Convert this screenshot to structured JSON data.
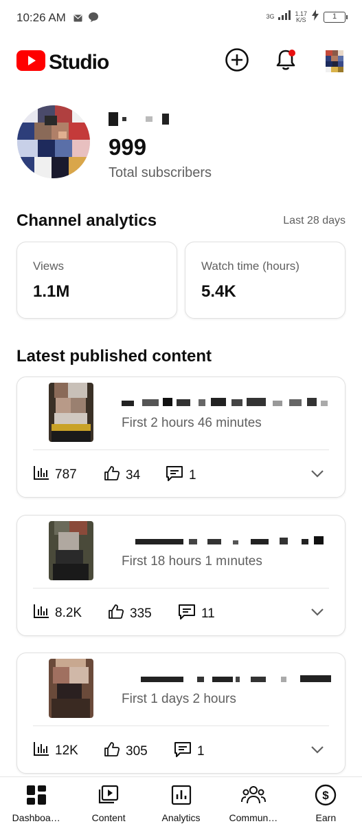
{
  "status_bar": {
    "time": "10:26 AM",
    "network": "3G",
    "speed_value": "1.17",
    "speed_unit": "K/S",
    "battery": "1",
    "icons": [
      "mail-icon",
      "chat-bubble-icon",
      "signal-icon",
      "charging-icon",
      "battery-icon"
    ]
  },
  "header": {
    "logo_text": "Studio",
    "brand_color": "#ff0000",
    "icons": [
      "create-icon",
      "notifications-icon",
      "account-avatar"
    ]
  },
  "channel": {
    "subscribers": "999",
    "subscribers_label": "Total subscribers"
  },
  "analytics": {
    "title": "Channel analytics",
    "period": "Last 28 days",
    "cards": [
      {
        "label": "Views",
        "value": "1.1M"
      },
      {
        "label": "Watch time (hours)",
        "value": "5.4K"
      }
    ]
  },
  "latest": {
    "title": "Latest published content",
    "items": [
      {
        "meta": "First 2 hours 46 minutes",
        "views": "787",
        "likes": "34",
        "comments": "1"
      },
      {
        "meta": "First 18 hours 1 mınutes",
        "views": "8.2K",
        "likes": "335",
        "comments": "11"
      },
      {
        "meta": "First 1 days 2 hours",
        "views": "12K",
        "likes": "305",
        "comments": "1"
      }
    ]
  },
  "nav": {
    "items": [
      {
        "label": "Dashboa…",
        "icon": "dashboard-icon"
      },
      {
        "label": "Content",
        "icon": "content-icon"
      },
      {
        "label": "Analytics",
        "icon": "analytics-icon"
      },
      {
        "label": "Commun…",
        "icon": "community-icon"
      },
      {
        "label": "Earn",
        "icon": "earn-icon"
      }
    ]
  }
}
